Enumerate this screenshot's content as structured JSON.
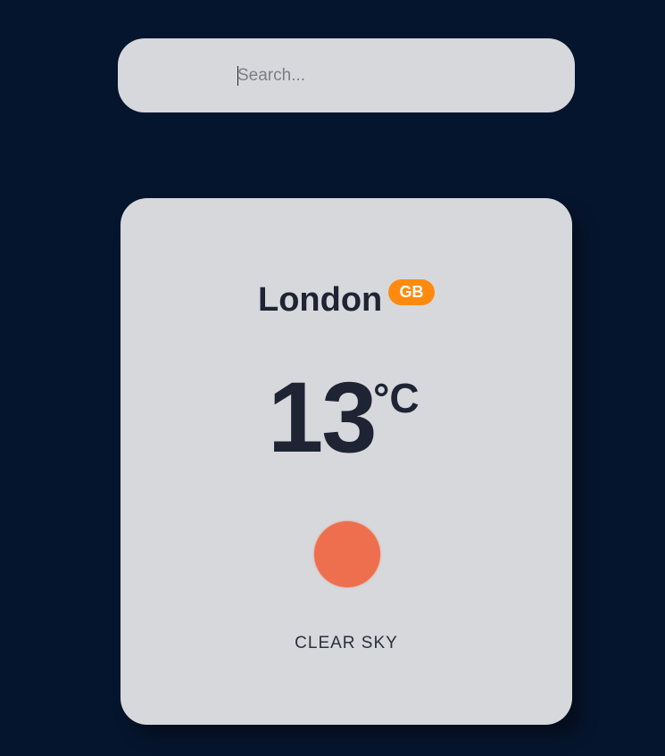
{
  "search": {
    "placeholder": "Search...",
    "value": ""
  },
  "weather": {
    "city": "London",
    "country_code": "GB",
    "temperature": "13",
    "unit": "°C",
    "description": "CLEAR SKY",
    "icon": "sun-icon"
  },
  "colors": {
    "background": "#06152e",
    "card": "#d7d8dc",
    "badge": "#ff8a0d",
    "sun": "#ee6f4e",
    "text": "#1e2434"
  }
}
